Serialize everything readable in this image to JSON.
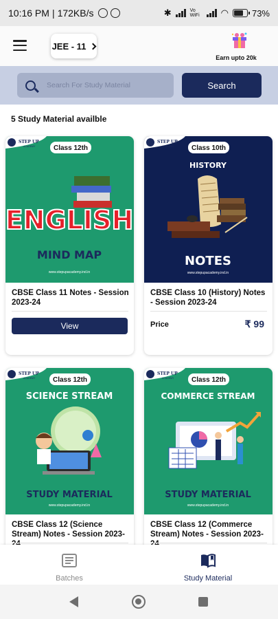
{
  "status_bar": {
    "time": "10:16 PM",
    "network_speed": "172KB/s",
    "battery": "73%",
    "vowifi": "Vo WiFi"
  },
  "header": {
    "batch_selector": "JEE - 11",
    "earn_label": "Earn upto 20k"
  },
  "search": {
    "placeholder": "Search For Study Material",
    "button_label": "Search"
  },
  "results_count_text": "5 Study Material availble",
  "cards": [
    {
      "class_badge": "Class 12th",
      "brand": "STEP UP",
      "brand_sub": "ACADEMY",
      "poster_title": "ENGLISH",
      "poster_subtitle": "MIND MAP",
      "poster_url": "www.stepupacademy.ind.in",
      "title": "CBSE Class 11 Notes - Session 2023-24",
      "action_label": "View",
      "bg_color": "#1e9a6e"
    },
    {
      "class_badge": "Class 10th",
      "brand": "STEP UP",
      "brand_sub": "ACADEMY",
      "poster_title": "HISTORY",
      "poster_subtitle": "NOTES",
      "poster_url": "www.stepupacademy.ind.in",
      "title": "CBSE Class 10 (History) Notes - Session 2023-24",
      "price_label": "Price",
      "price_value": "₹ 99",
      "bg_color": "#0f1f52"
    },
    {
      "class_badge": "Class 12th",
      "brand": "STEP UP",
      "brand_sub": "ACADEMY",
      "poster_title": "SCIENCE STREAM",
      "poster_subtitle": "STUDY MATERIAL",
      "poster_url": "www.stepupacademy.ind.in",
      "title": "CBSE Class 12 (Science Stream) Notes - Session 2023-24",
      "bg_color": "#1e9a6e"
    },
    {
      "class_badge": "Class 12th",
      "brand": "STEP UP",
      "brand_sub": "ACADEMY",
      "poster_title": "COMMERCE STREAM",
      "poster_subtitle": "STUDY MATERIAL",
      "poster_url": "www.stepupacademy.ind.in",
      "title": "CBSE Class 12 (Commerce Stream) Notes - Session 2023-24",
      "bg_color": "#1e9a6e"
    }
  ],
  "bottom_nav": [
    {
      "label": "Batches",
      "icon": "book-stack-icon",
      "active": false
    },
    {
      "label": "Study Material",
      "icon": "open-book-icon",
      "active": true
    }
  ],
  "colors": {
    "primary": "#1b2a5c",
    "search_band": "#c7cfe3",
    "poster_green": "#1e9a6e",
    "poster_navy": "#0f1f52"
  }
}
